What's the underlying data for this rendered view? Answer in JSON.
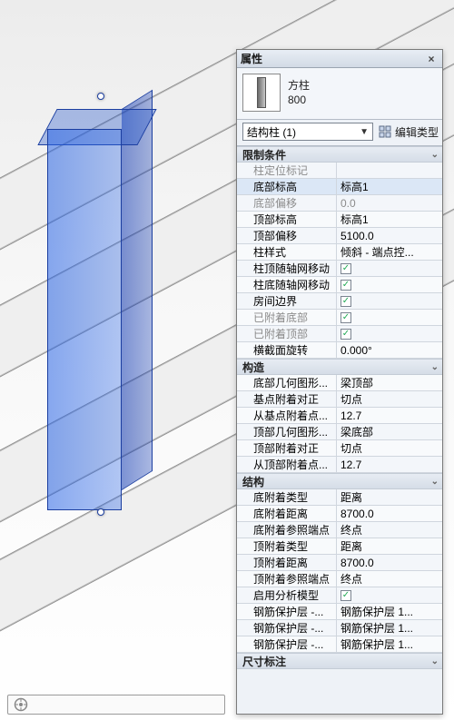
{
  "palette": {
    "title": "属性",
    "close": "×",
    "family_name": "方柱",
    "type_name": "800",
    "selector": "结构柱 (1)",
    "edit_type_label": "编辑类型"
  },
  "sections": {
    "constraints": "限制条件",
    "construction": "构造",
    "structural": "结构",
    "dimensions": "尺寸标注"
  },
  "rows": {
    "loc_mark": {
      "label": "柱定位标记",
      "value": ""
    },
    "base_level": {
      "label": "底部标高",
      "value": "标高1"
    },
    "base_offset": {
      "label": "底部偏移",
      "value": "0.0"
    },
    "top_level": {
      "label": "顶部标高",
      "value": "标高1"
    },
    "top_offset": {
      "label": "顶部偏移",
      "value": "5100.0"
    },
    "col_style": {
      "label": "柱样式",
      "value": "倾斜 - 端点控..."
    },
    "top_move": {
      "label": "柱顶随轴网移动",
      "value": "✓"
    },
    "base_move": {
      "label": "柱底随轴网移动",
      "value": "✓"
    },
    "room_bound": {
      "label": "房间边界",
      "value": "✓"
    },
    "att_base": {
      "label": "已附着底部",
      "value": "✓"
    },
    "att_top": {
      "label": "已附着顶部",
      "value": "✓"
    },
    "cross_rot": {
      "label": "横截面旋转",
      "value": "0.000°"
    },
    "base_geo": {
      "label": "底部几何图形...",
      "value": "梁顶部"
    },
    "base_just": {
      "label": "基点附着对正",
      "value": "切点"
    },
    "from_base": {
      "label": "从基点附着点...",
      "value": "12.7"
    },
    "top_geo": {
      "label": "顶部几何图形...",
      "value": "梁底部"
    },
    "top_just": {
      "label": "顶部附着对正",
      "value": "切点"
    },
    "from_top": {
      "label": "从顶部附着点...",
      "value": "12.7"
    },
    "b_att_type": {
      "label": "底附着类型",
      "value": "距离"
    },
    "b_att_dist": {
      "label": "底附着距离",
      "value": "8700.0"
    },
    "b_att_ref": {
      "label": "底附着参照端点",
      "value": "终点"
    },
    "t_att_type": {
      "label": "顶附着类型",
      "value": "距离"
    },
    "t_att_dist": {
      "label": "顶附着距离",
      "value": "8700.0"
    },
    "t_att_ref": {
      "label": "顶附着参照端点",
      "value": "终点"
    },
    "enable_an": {
      "label": "启用分析模型",
      "value": "✓"
    },
    "cover1": {
      "label": "钢筋保护层 -...",
      "value": "钢筋保护层 1..."
    },
    "cover2": {
      "label": "钢筋保护层 -...",
      "value": "钢筋保护层 1..."
    },
    "cover3": {
      "label": "钢筋保护层 -...",
      "value": "钢筋保护层 1..."
    }
  }
}
